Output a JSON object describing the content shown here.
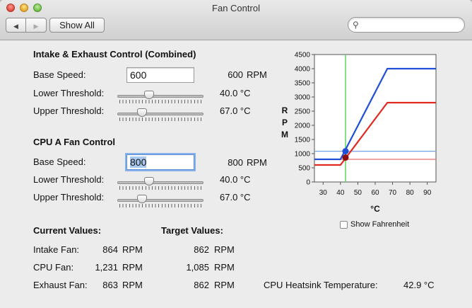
{
  "window": {
    "title": "Fan Control"
  },
  "toolbar": {
    "back_glyph": "◀",
    "forward_glyph": "▶",
    "show_all": "Show All",
    "search_placeholder": ""
  },
  "intake": {
    "heading": "Intake & Exhaust Control (Combined)",
    "base_label": "Base Speed:",
    "base_value": "600",
    "base_readout": "600",
    "base_unit": "RPM",
    "lower_label": "Lower Threshold:",
    "lower_value": "40.0 °C",
    "lower_slider": 0.35,
    "upper_label": "Upper Threshold:",
    "upper_value": "67.0 °C",
    "upper_slider": 0.26
  },
  "cpu": {
    "heading": "CPU A Fan Control",
    "base_label": "Base Speed:",
    "base_value": "800",
    "base_readout": "800",
    "base_unit": "RPM",
    "lower_label": "Lower Threshold:",
    "lower_value": "40.0 °C",
    "lower_slider": 0.35,
    "upper_label": "Upper Threshold:",
    "upper_value": "67.0 °C",
    "upper_slider": 0.26
  },
  "current": {
    "heading": "Current Values:",
    "rows": [
      {
        "label": "Intake Fan:",
        "value": "864",
        "unit": "RPM"
      },
      {
        "label": "CPU Fan:",
        "value": "1,231",
        "unit": "RPM"
      },
      {
        "label": "Exhaust Fan:",
        "value": "863",
        "unit": "RPM"
      }
    ]
  },
  "target": {
    "heading": "Target Values:",
    "rows": [
      {
        "value": "862",
        "unit": "RPM"
      },
      {
        "value": "1,085",
        "unit": "RPM"
      },
      {
        "value": "862",
        "unit": "RPM"
      }
    ]
  },
  "heatsink": {
    "label": "CPU Heatsink Temperature:",
    "value": "42.9 °C"
  },
  "fahrenheit": {
    "label": "Show Fahrenheit",
    "checked": false
  },
  "chart_data": {
    "type": "line",
    "xlabel": "°C",
    "ylabel": "RPM",
    "xlim": [
      25,
      95
    ],
    "ylim": [
      0,
      4500
    ],
    "xticks": [
      30,
      40,
      50,
      60,
      70,
      80,
      90
    ],
    "yticks": [
      0,
      500,
      1000,
      1500,
      2000,
      2500,
      3000,
      3500,
      4000,
      4500
    ],
    "current_temp": 42.9,
    "colors": {
      "cpu": "#1f4fd6",
      "intake": "#e02a1f",
      "temp_line": "#5cd65c",
      "cpu_target": "#7aa2e8",
      "intake_target": "#e8706a"
    },
    "series": [
      {
        "key": "cpu",
        "x": [
          25,
          40,
          67,
          95
        ],
        "y": [
          800,
          800,
          4000,
          4000
        ]
      },
      {
        "key": "intake",
        "x": [
          25,
          40,
          67,
          95
        ],
        "y": [
          600,
          600,
          2800,
          2800
        ]
      }
    ],
    "markers": [
      {
        "key": "cpu",
        "x": 42.9,
        "y": 1085,
        "color": "#1f4fd6"
      },
      {
        "key": "intake",
        "x": 42.9,
        "y": 862,
        "color": "#8b0e0e"
      }
    ],
    "target_lines": [
      {
        "key": "cpu",
        "y": 1085
      },
      {
        "key": "intake",
        "y": 800
      }
    ]
  }
}
